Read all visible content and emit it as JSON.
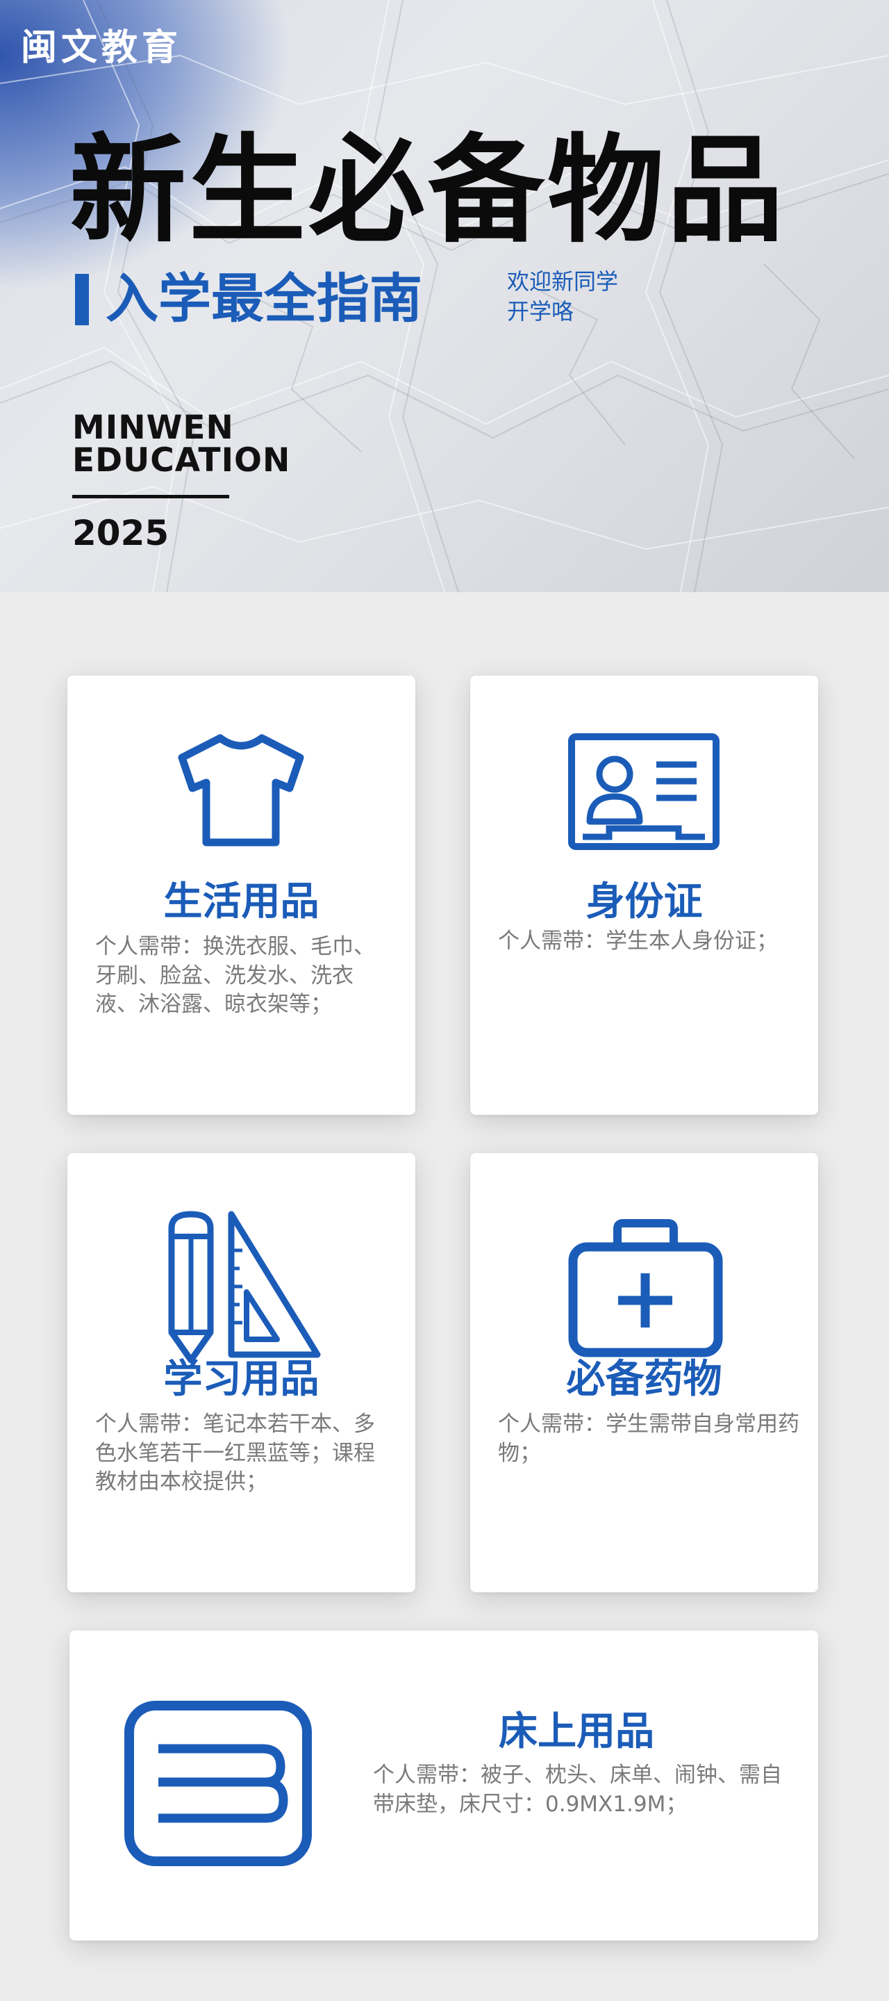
{
  "header": {
    "logo": "闽文教育",
    "title": "新生必备物品",
    "subtitle": "入学最全指南",
    "welcome_line1": "欢迎新同学",
    "welcome_line2": "开学咯",
    "brand_line1": "MINWEN",
    "brand_line2": "EDUCATION",
    "year": "2025"
  },
  "colors": {
    "accent": "#1b5cb8",
    "title": "#0b0b0b",
    "desc": "#7a7a7a",
    "background": "#ececec",
    "card": "#ffffff"
  },
  "cards": [
    {
      "icon": "tshirt-icon",
      "title": "生活用品",
      "desc": "个人需带：换洗衣服、毛巾、牙刷、脸盆、洗发水、洗衣液、沐浴露、晾衣架等；"
    },
    {
      "icon": "id-card-icon",
      "title": "身份证",
      "desc": "个人需带：学生本人身份证；"
    },
    {
      "icon": "pencil-ruler-icon",
      "title": "学习用品",
      "desc": "个人需带：笔记本若干本、多色水笔若干一红黑蓝等；课程教材由本校提供；"
    },
    {
      "icon": "medical-kit-icon",
      "title": "必备药物",
      "desc": "个人需带：学生需带自身常用药物；"
    },
    {
      "icon": "bed-icon",
      "title": "床上用品",
      "desc": "个人需带：被子、枕头、床单、闹钟、需自带床垫，床尺寸：0.9MX1.9M；"
    }
  ]
}
